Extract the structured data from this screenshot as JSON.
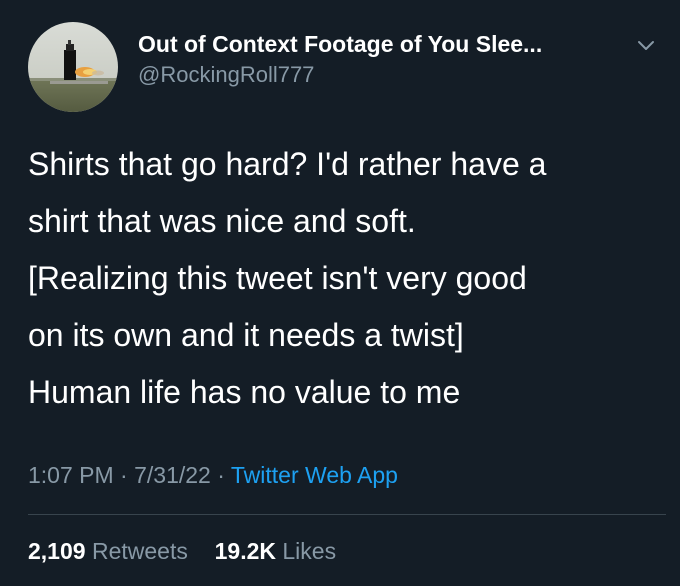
{
  "tweet": {
    "author": {
      "display_name": "Out of Context Footage of You Slee...",
      "handle": "@RockingRoll777",
      "avatar_icon": "profile-photo-rocket-car-on-runway"
    },
    "menu_icon": "chevron-down-icon",
    "text_lines": [
      "Shirts that go hard? I'd rather have a",
      "shirt that was nice and soft.",
      "[Realizing this tweet isn't very good",
      "on its own and it needs a twist]",
      "Human life has no value to me"
    ],
    "meta": {
      "time": "1:07 PM",
      "separator": "·",
      "date": "7/31/22",
      "source": "Twitter Web App"
    },
    "stats": {
      "retweets_count": "2,109",
      "retweets_label": "Retweets",
      "likes_count": "19.2K",
      "likes_label": "Likes"
    }
  },
  "colors": {
    "background": "#141d26",
    "primary_text": "#ffffff",
    "secondary_text": "#8899a6",
    "link": "#1da1f2",
    "divider": "#38444d"
  }
}
